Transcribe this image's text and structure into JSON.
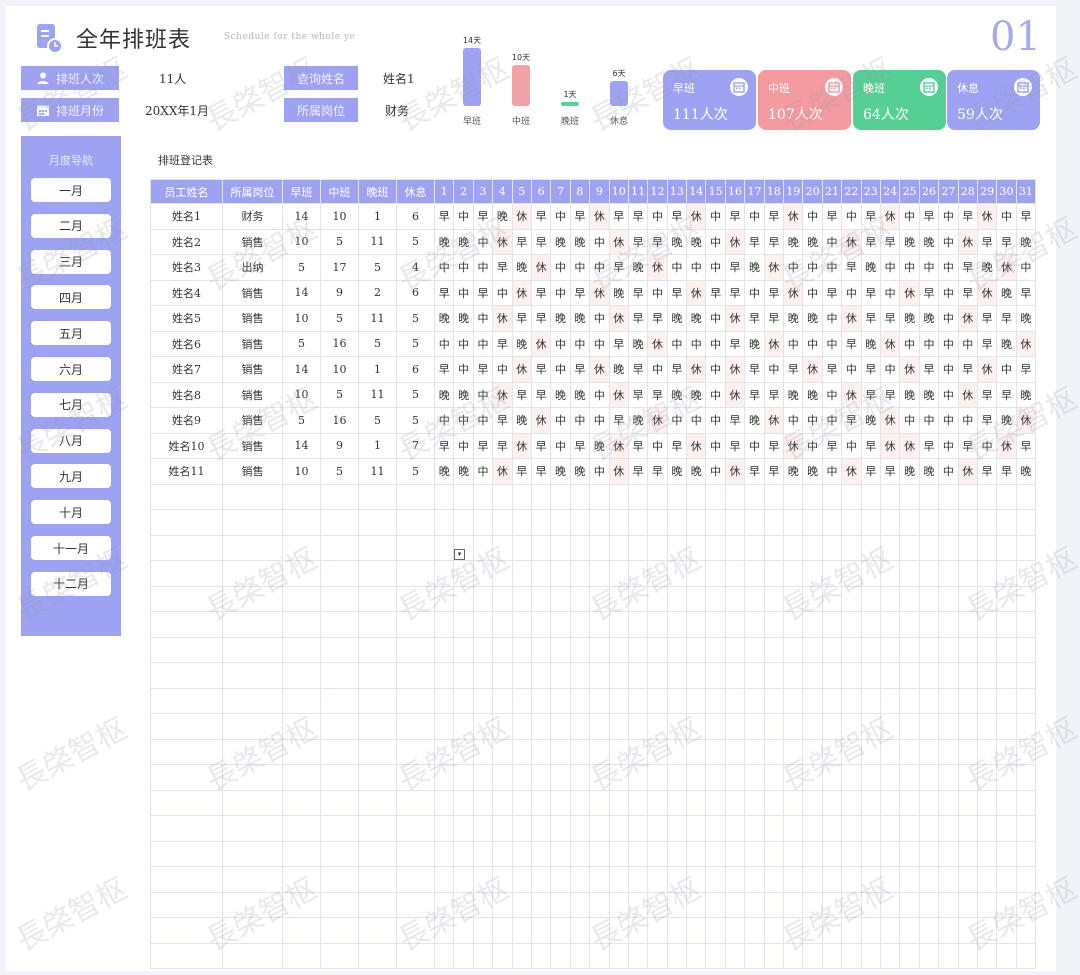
{
  "header": {
    "title": "全年排班表",
    "subtitle": "Schedule for the whole ye",
    "page_no": "01"
  },
  "info": {
    "staff_count_label": "排班人次",
    "staff_count_value": "11人",
    "month_label": "排班月份",
    "month_value": "20XX年1月",
    "query_name_label": "查询姓名",
    "query_name_value": "姓名1",
    "dept_label": "所属岗位",
    "dept_value": "财务"
  },
  "mini_chart": {
    "bars": [
      {
        "name": "早班",
        "value_label": "14天",
        "value": 14,
        "color": "#9da2f2"
      },
      {
        "name": "中班",
        "value_label": "10天",
        "value": 10,
        "color": "#f2a3a8"
      },
      {
        "name": "晚班",
        "value_label": "1天",
        "value": 1,
        "color": "#56d29b"
      },
      {
        "name": "休息",
        "value_label": "6天",
        "value": 6,
        "color": "#9da2f2"
      }
    ]
  },
  "cards": [
    {
      "label": "早班",
      "value": "111人次",
      "color": "#9da2f2"
    },
    {
      "label": "中班",
      "value": "107人次",
      "color": "#f49ba0"
    },
    {
      "label": "晚班",
      "value": "64人次",
      "color": "#56cf95"
    },
    {
      "label": "休息",
      "value": "59人次",
      "color": "#9da2f2"
    }
  ],
  "sidebar": {
    "title": "月度导航",
    "months": [
      "一月",
      "二月",
      "三月",
      "四月",
      "五月",
      "六月",
      "七月",
      "八月",
      "九月",
      "十月",
      "十一月",
      "十二月"
    ]
  },
  "table": {
    "title": "排班登记表",
    "headers": [
      "员工姓名",
      "所属岗位",
      "早班",
      "中班",
      "晚班",
      "休息"
    ],
    "days": [
      "1",
      "2",
      "3",
      "4",
      "5",
      "6",
      "7",
      "8",
      "9",
      "10",
      "11",
      "12",
      "13",
      "14",
      "15",
      "16",
      "17",
      "18",
      "19",
      "20",
      "21",
      "22",
      "23",
      "24",
      "25",
      "26",
      "27",
      "28",
      "29",
      "30",
      "31"
    ],
    "rows": [
      {
        "name": "姓名1",
        "dept": "财务",
        "early": "14",
        "mid": "10",
        "late": "1",
        "rest": "6",
        "shifts": "早中早晚休早中早休早早中早休中早中早休中早中早休中早中早休中早"
      },
      {
        "name": "姓名2",
        "dept": "销售",
        "early": "10",
        "mid": "5",
        "late": "11",
        "rest": "5",
        "shifts": "晚晚中休早早晚晚中休早早晚晚中休早早晚晚中休早早晚晚中休早早晚"
      },
      {
        "name": "姓名3",
        "dept": "出纳",
        "early": "5",
        "mid": "17",
        "late": "5",
        "rest": "4",
        "shifts": "中中中早晚休中中中早晚休中中中早晚休中中中早晚中中中中早晚休中"
      },
      {
        "name": "姓名4",
        "dept": "销售",
        "early": "14",
        "mid": "9",
        "late": "2",
        "rest": "6",
        "shifts": "早中早中休早中早休晚早中早休早早中早休中早中早中休早中早休晚早"
      },
      {
        "name": "姓名5",
        "dept": "销售",
        "early": "10",
        "mid": "5",
        "late": "11",
        "rest": "5",
        "shifts": "晚晚中休早早晚晚中休早早晚晚中休早早晚晚中休早早晚晚中休早早晚"
      },
      {
        "name": "姓名6",
        "dept": "销售",
        "early": "5",
        "mid": "16",
        "late": "5",
        "rest": "5",
        "shifts": "中中中早晚休中中中早晚休中中中早晚休中中中早晚休中中中中早晚休中"
      },
      {
        "name": "姓名7",
        "dept": "销售",
        "early": "14",
        "mid": "10",
        "late": "1",
        "rest": "6",
        "shifts": "早中早中休早中早休晚早中早休中休早中早休早中早中休早中早休中早"
      },
      {
        "name": "姓名8",
        "dept": "销售",
        "early": "10",
        "mid": "5",
        "late": "11",
        "rest": "5",
        "shifts": "晚晚中休早早晚晚中休早早晚晚中休早早晚晚中休早早晚晚中休早早晚"
      },
      {
        "name": "姓名9",
        "dept": "销售",
        "early": "5",
        "mid": "16",
        "late": "5",
        "rest": "5",
        "shifts": "中中中早晚休中中中早晚休中中中早晚休中中中早晚休中中中中早晚休中"
      },
      {
        "name": "姓名10",
        "dept": "销售",
        "early": "14",
        "mid": "9",
        "late": "1",
        "rest": "7",
        "shifts": "早中早早休早中早晚休早中早休中早中早休中早中早休休早中早中休早"
      },
      {
        "name": "姓名11",
        "dept": "销售",
        "early": "10",
        "mid": "5",
        "late": "11",
        "rest": "5",
        "shifts": "晚晚中休早早晚晚中休早早晚晚中休早早晚晚中休早早晚晚中休早早晚"
      }
    ],
    "empty_rows": 19
  },
  "watermark": "長棨智枢"
}
